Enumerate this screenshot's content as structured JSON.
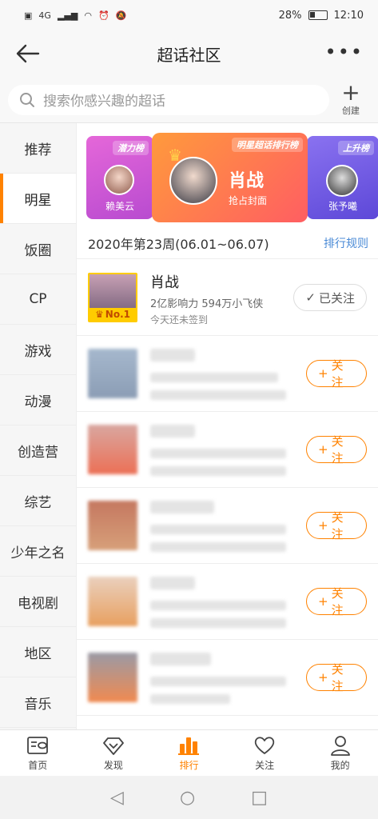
{
  "status": {
    "network": "4G",
    "battery": "28%",
    "time": "12:10"
  },
  "nav": {
    "title": "超话社区",
    "more": "•••"
  },
  "search": {
    "placeholder": "搜索你感兴趣的超话",
    "create_label": "创建"
  },
  "sidebar": {
    "items": [
      {
        "label": "推荐"
      },
      {
        "label": "明星"
      },
      {
        "label": "饭圈"
      },
      {
        "label": "CP"
      },
      {
        "label": "游戏"
      },
      {
        "label": "动漫"
      },
      {
        "label": "创造营"
      },
      {
        "label": "综艺"
      },
      {
        "label": "少年之名"
      },
      {
        "label": "电视剧"
      },
      {
        "label": "地区"
      },
      {
        "label": "音乐"
      }
    ],
    "active_index": 1
  },
  "banners": {
    "left": {
      "tag": "潜力榜",
      "name": "赖美云"
    },
    "center": {
      "tag": "明星超话排行榜",
      "name": "肖战",
      "subtitle": "抢占封面"
    },
    "right": {
      "tag": "上升榜",
      "name": "张予曦"
    }
  },
  "week": {
    "title": "2020年第23周(06.01~06.07)",
    "rules_link": "排行规则"
  },
  "list": {
    "first": {
      "name": "肖战",
      "stats": "2亿影响力 594万小飞侠",
      "sign_status": "今天还未签到",
      "rank_label": "No.1",
      "button": "已关注"
    },
    "follow_label": "关注"
  },
  "tabs": [
    {
      "label": "首页"
    },
    {
      "label": "发现"
    },
    {
      "label": "排行"
    },
    {
      "label": "关注"
    },
    {
      "label": "我的"
    }
  ],
  "colors": {
    "accent": "#ff8200",
    "link": "#4a8ad6"
  }
}
